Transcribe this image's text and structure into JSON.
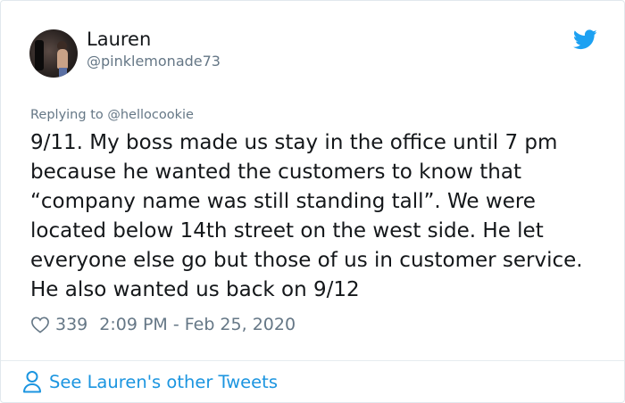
{
  "author": {
    "name": "Lauren",
    "handle": "@pinklemonade73"
  },
  "reply": {
    "prefix": "Replying to ",
    "mention": "@hellocookie"
  },
  "tweet": {
    "text": "9/11. My boss made us stay in the office until 7 pm because he wanted the customers to know that “company name was still standing tall”. We were located below 14th street on the west side. He let everyone else go but those of us in customer service. He also wanted us back on 9/12"
  },
  "meta": {
    "likes": "339",
    "timestamp": "2:09 PM - Feb 25, 2020"
  },
  "footer": {
    "link_label": "See Lauren's other Tweets"
  },
  "icons": {
    "brand": "twitter-bird-icon",
    "like": "heart-icon",
    "profile": "person-icon"
  },
  "colors": {
    "brand": "#1da1f2",
    "link": "#1b95e0",
    "muted": "#657786",
    "text": "#14171a"
  }
}
